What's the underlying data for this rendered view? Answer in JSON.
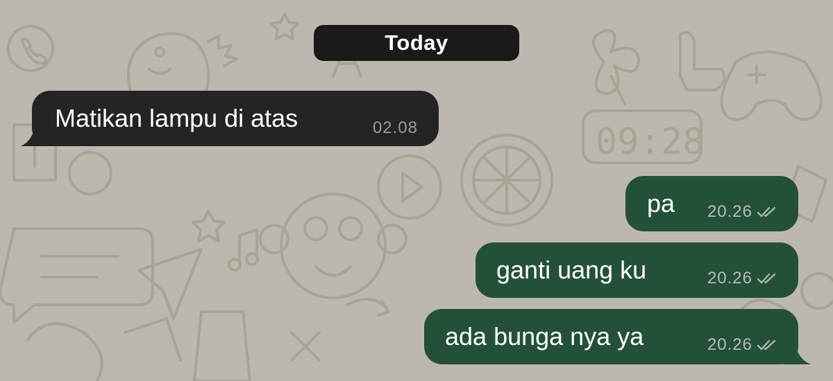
{
  "chat": {
    "date_separator": "Today",
    "messages": [
      {
        "direction": "incoming",
        "text": "Matikan lampu di atas",
        "time": "02.08"
      },
      {
        "direction": "outgoing",
        "text": "pa",
        "time": "20.26",
        "status_icon": "double-check-icon"
      },
      {
        "direction": "outgoing",
        "text": "ganti uang ku",
        "time": "20.26",
        "status_icon": "double-check-icon"
      },
      {
        "direction": "outgoing",
        "text": "ada bunga nya ya",
        "time": "20.26",
        "status_icon": "double-check-icon"
      }
    ]
  },
  "colors": {
    "wallpaper": "#bdb8ae",
    "incoming_bubble": "#242424",
    "outgoing_bubble": "#24503a",
    "date_pill": "#1a1a1a"
  }
}
